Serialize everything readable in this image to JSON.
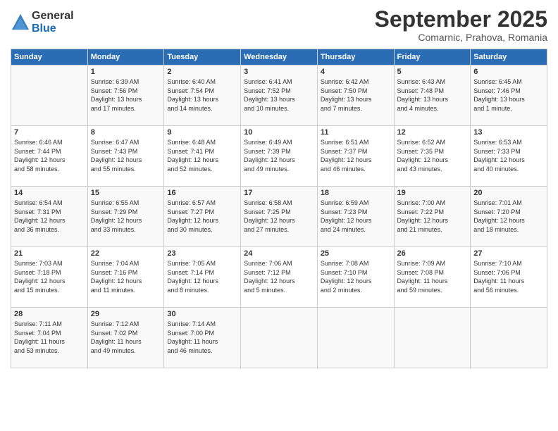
{
  "logo": {
    "general": "General",
    "blue": "Blue"
  },
  "title": "September 2025",
  "subtitle": "Comarnic, Prahova, Romania",
  "days_header": [
    "Sunday",
    "Monday",
    "Tuesday",
    "Wednesday",
    "Thursday",
    "Friday",
    "Saturday"
  ],
  "weeks": [
    [
      {
        "day": "",
        "info": ""
      },
      {
        "day": "1",
        "info": "Sunrise: 6:39 AM\nSunset: 7:56 PM\nDaylight: 13 hours\nand 17 minutes."
      },
      {
        "day": "2",
        "info": "Sunrise: 6:40 AM\nSunset: 7:54 PM\nDaylight: 13 hours\nand 14 minutes."
      },
      {
        "day": "3",
        "info": "Sunrise: 6:41 AM\nSunset: 7:52 PM\nDaylight: 13 hours\nand 10 minutes."
      },
      {
        "day": "4",
        "info": "Sunrise: 6:42 AM\nSunset: 7:50 PM\nDaylight: 13 hours\nand 7 minutes."
      },
      {
        "day": "5",
        "info": "Sunrise: 6:43 AM\nSunset: 7:48 PM\nDaylight: 13 hours\nand 4 minutes."
      },
      {
        "day": "6",
        "info": "Sunrise: 6:45 AM\nSunset: 7:46 PM\nDaylight: 13 hours\nand 1 minute."
      }
    ],
    [
      {
        "day": "7",
        "info": "Sunrise: 6:46 AM\nSunset: 7:44 PM\nDaylight: 12 hours\nand 58 minutes."
      },
      {
        "day": "8",
        "info": "Sunrise: 6:47 AM\nSunset: 7:43 PM\nDaylight: 12 hours\nand 55 minutes."
      },
      {
        "day": "9",
        "info": "Sunrise: 6:48 AM\nSunset: 7:41 PM\nDaylight: 12 hours\nand 52 minutes."
      },
      {
        "day": "10",
        "info": "Sunrise: 6:49 AM\nSunset: 7:39 PM\nDaylight: 12 hours\nand 49 minutes."
      },
      {
        "day": "11",
        "info": "Sunrise: 6:51 AM\nSunset: 7:37 PM\nDaylight: 12 hours\nand 46 minutes."
      },
      {
        "day": "12",
        "info": "Sunrise: 6:52 AM\nSunset: 7:35 PM\nDaylight: 12 hours\nand 43 minutes."
      },
      {
        "day": "13",
        "info": "Sunrise: 6:53 AM\nSunset: 7:33 PM\nDaylight: 12 hours\nand 40 minutes."
      }
    ],
    [
      {
        "day": "14",
        "info": "Sunrise: 6:54 AM\nSunset: 7:31 PM\nDaylight: 12 hours\nand 36 minutes."
      },
      {
        "day": "15",
        "info": "Sunrise: 6:55 AM\nSunset: 7:29 PM\nDaylight: 12 hours\nand 33 minutes."
      },
      {
        "day": "16",
        "info": "Sunrise: 6:57 AM\nSunset: 7:27 PM\nDaylight: 12 hours\nand 30 minutes."
      },
      {
        "day": "17",
        "info": "Sunrise: 6:58 AM\nSunset: 7:25 PM\nDaylight: 12 hours\nand 27 minutes."
      },
      {
        "day": "18",
        "info": "Sunrise: 6:59 AM\nSunset: 7:23 PM\nDaylight: 12 hours\nand 24 minutes."
      },
      {
        "day": "19",
        "info": "Sunrise: 7:00 AM\nSunset: 7:22 PM\nDaylight: 12 hours\nand 21 minutes."
      },
      {
        "day": "20",
        "info": "Sunrise: 7:01 AM\nSunset: 7:20 PM\nDaylight: 12 hours\nand 18 minutes."
      }
    ],
    [
      {
        "day": "21",
        "info": "Sunrise: 7:03 AM\nSunset: 7:18 PM\nDaylight: 12 hours\nand 15 minutes."
      },
      {
        "day": "22",
        "info": "Sunrise: 7:04 AM\nSunset: 7:16 PM\nDaylight: 12 hours\nand 11 minutes."
      },
      {
        "day": "23",
        "info": "Sunrise: 7:05 AM\nSunset: 7:14 PM\nDaylight: 12 hours\nand 8 minutes."
      },
      {
        "day": "24",
        "info": "Sunrise: 7:06 AM\nSunset: 7:12 PM\nDaylight: 12 hours\nand 5 minutes."
      },
      {
        "day": "25",
        "info": "Sunrise: 7:08 AM\nSunset: 7:10 PM\nDaylight: 12 hours\nand 2 minutes."
      },
      {
        "day": "26",
        "info": "Sunrise: 7:09 AM\nSunset: 7:08 PM\nDaylight: 11 hours\nand 59 minutes."
      },
      {
        "day": "27",
        "info": "Sunrise: 7:10 AM\nSunset: 7:06 PM\nDaylight: 11 hours\nand 56 minutes."
      }
    ],
    [
      {
        "day": "28",
        "info": "Sunrise: 7:11 AM\nSunset: 7:04 PM\nDaylight: 11 hours\nand 53 minutes."
      },
      {
        "day": "29",
        "info": "Sunrise: 7:12 AM\nSunset: 7:02 PM\nDaylight: 11 hours\nand 49 minutes."
      },
      {
        "day": "30",
        "info": "Sunrise: 7:14 AM\nSunset: 7:00 PM\nDaylight: 11 hours\nand 46 minutes."
      },
      {
        "day": "",
        "info": ""
      },
      {
        "day": "",
        "info": ""
      },
      {
        "day": "",
        "info": ""
      },
      {
        "day": "",
        "info": ""
      }
    ]
  ]
}
